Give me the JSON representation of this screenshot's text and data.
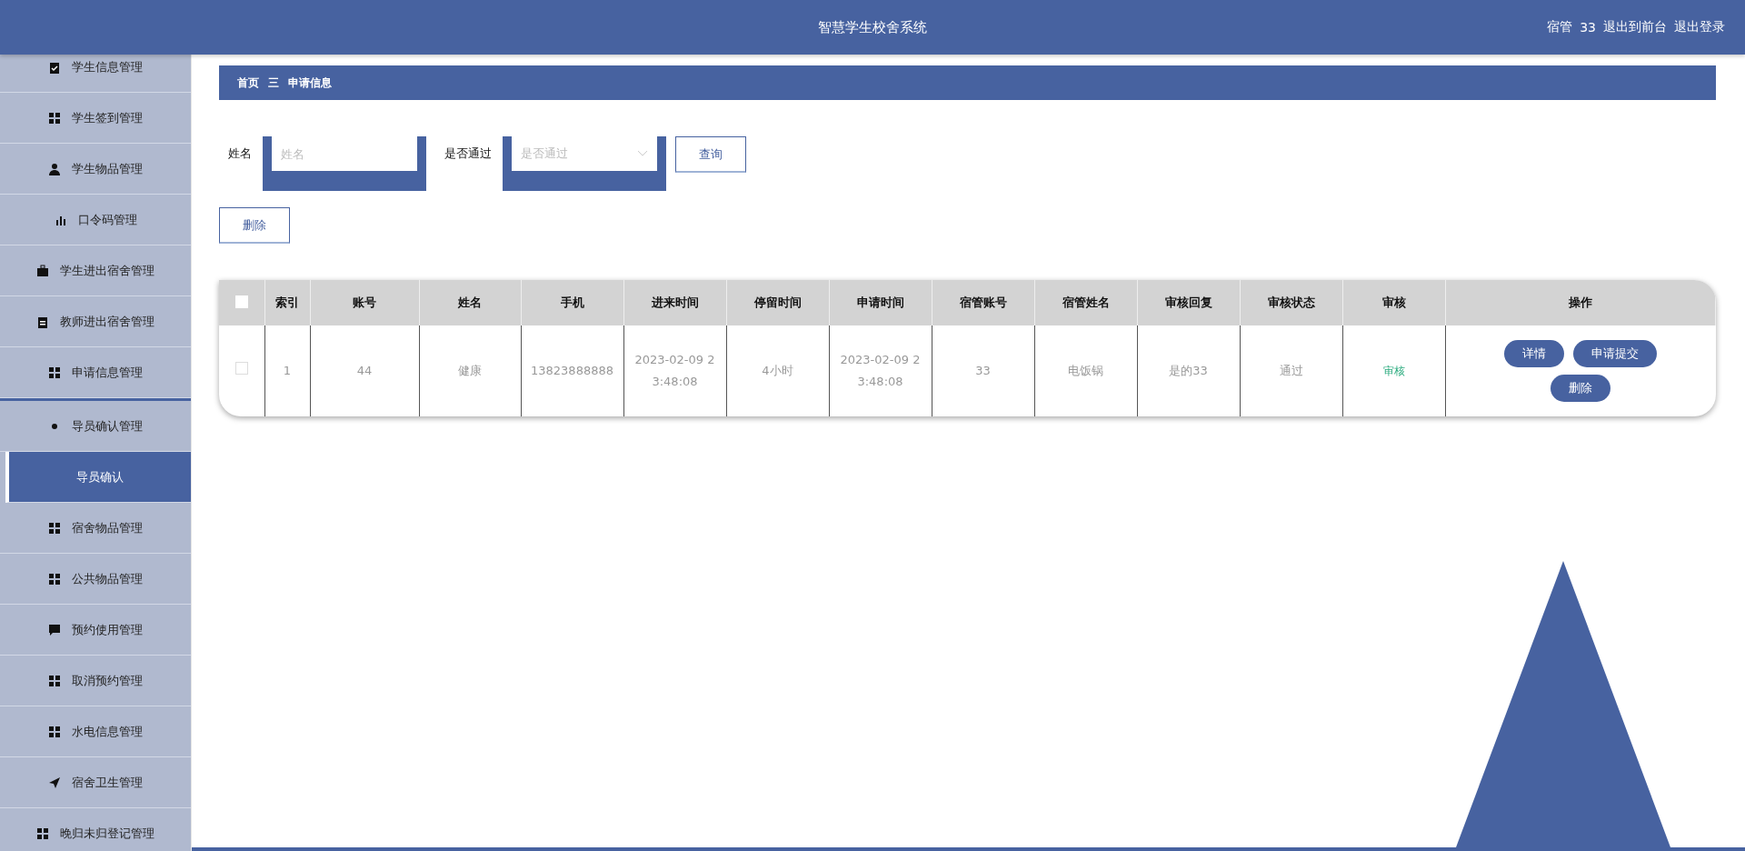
{
  "header": {
    "title": "智慧学生校舍系统",
    "user_role": "宿管",
    "user_name": "33",
    "links": [
      "退出到前台",
      "退出登录"
    ]
  },
  "sidebar": {
    "items": [
      {
        "label": "学生信息管理",
        "selected": false
      },
      {
        "label": "学生签到管理",
        "selected": false
      },
      {
        "label": "学生物品管理",
        "selected": false
      },
      {
        "label": "口令码管理",
        "selected": false
      },
      {
        "label": "学生进出宿舍管理",
        "selected": false
      },
      {
        "label": "教师进出宿舍管理",
        "selected": false
      },
      {
        "label": "申请信息管理",
        "selected": false
      },
      {
        "label": "导员确认管理",
        "selected": false,
        "expanded": true,
        "children": [
          {
            "label": "导员确认",
            "selected": true
          }
        ]
      },
      {
        "label": "宿舍物品管理",
        "selected": false
      },
      {
        "label": "公共物品管理",
        "selected": false
      },
      {
        "label": "预约使用管理",
        "selected": false
      },
      {
        "label": "取消预约管理",
        "selected": false
      },
      {
        "label": "水电信息管理",
        "selected": false
      },
      {
        "label": "宿舍卫生管理",
        "selected": false
      },
      {
        "label": "晚归未归登记管理",
        "selected": false
      }
    ]
  },
  "breadcrumb": [
    "首页",
    "三",
    "申请信息"
  ],
  "search": {
    "name_label": "姓名",
    "name_placeholder": "姓名",
    "pass_label": "是否通过",
    "pass_placeholder": "是否通过",
    "query_button": "查询"
  },
  "delete_button": "删除",
  "table": {
    "header_checked": false,
    "columns": [
      "索引",
      "账号",
      "姓名",
      "手机",
      "进来时间",
      "停留时间",
      "申请时间",
      "宿管账号",
      "宿管姓名",
      "审核回复",
      "审核状态",
      "审核",
      "操作"
    ],
    "rows": [
      {
        "checked": false,
        "cells": [
          "1",
          "44",
          "健康",
          "13823888888",
          "2023-02-09 23:48:08",
          "4小时",
          "2023-02-09 23:48:08",
          "33",
          "电饭锅",
          "是的33",
          "通过"
        ],
        "review_link": "审核",
        "actions": [
          "详情",
          "申请提交",
          "删除"
        ]
      }
    ]
  }
}
